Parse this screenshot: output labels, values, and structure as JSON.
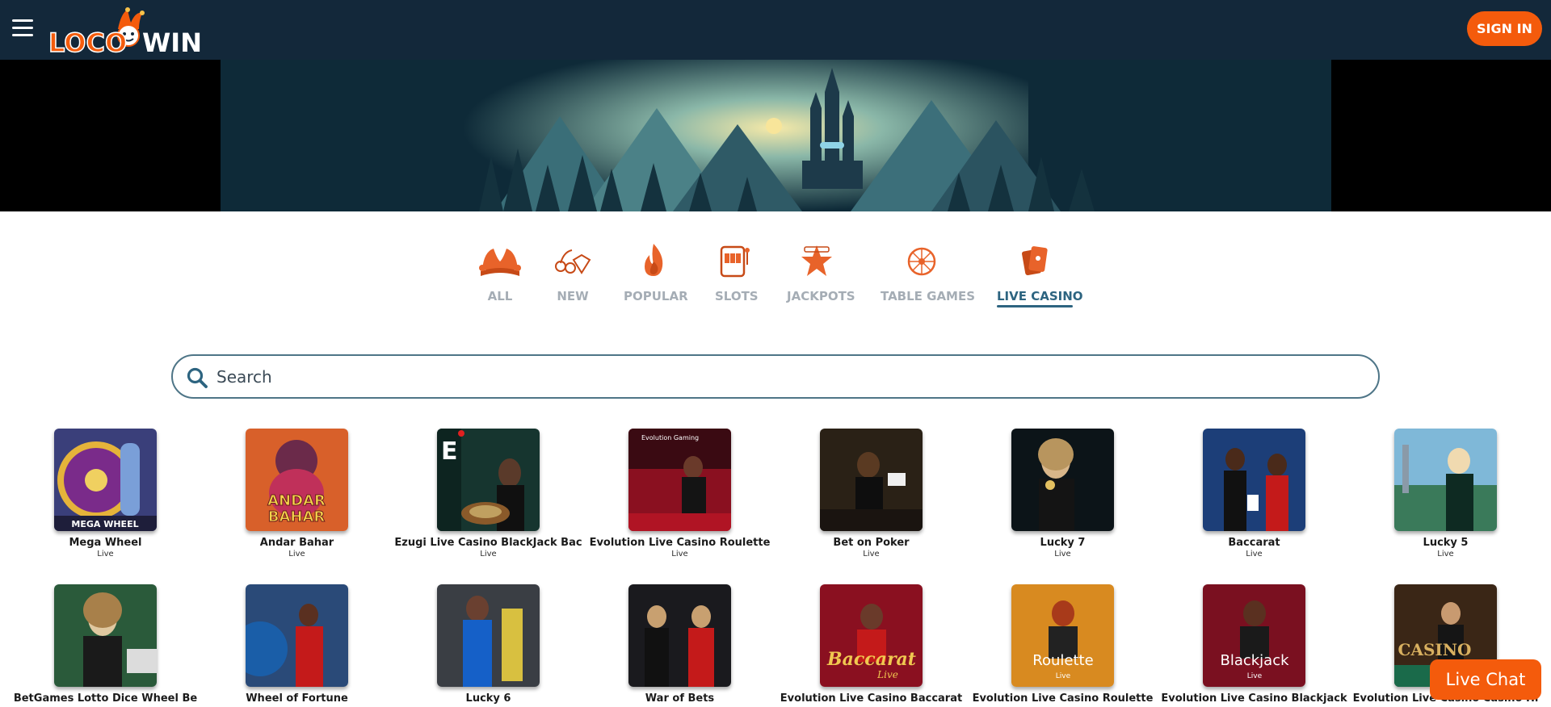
{
  "header": {
    "menu_icon": "hamburger-icon",
    "logo_text": "LOCOWIN",
    "signin_label": "SIGN IN",
    "accent": "#f45b0c",
    "bg": "#13283a"
  },
  "categories": [
    {
      "label": "ALL",
      "icon": "jester-hat-icon",
      "active": false
    },
    {
      "label": "NEW",
      "icon": "cherries-diamond-icon",
      "active": false
    },
    {
      "label": "POPULAR",
      "icon": "flame-icon",
      "active": false
    },
    {
      "label": "SLOTS",
      "icon": "slot-machine-icon",
      "active": false
    },
    {
      "label": "JACKPOTS",
      "icon": "star-jackpot-icon",
      "active": false
    },
    {
      "label": "TABLE GAMES",
      "icon": "roulette-wheel-icon",
      "active": false
    },
    {
      "label": "LIVE CASINO",
      "icon": "playing-cards-icon",
      "active": true
    }
  ],
  "search": {
    "placeholder": "Search",
    "value": ""
  },
  "games": [
    {
      "title": "Mega Wheel",
      "tag": "Live"
    },
    {
      "title": "Andar Bahar",
      "tag": "Live"
    },
    {
      "title": "Ezugi Live Casino BlackJack Bac",
      "tag": "Live"
    },
    {
      "title": "Evolution Live Casino Roulette",
      "tag": "Live"
    },
    {
      "title": "Bet on Poker",
      "tag": "Live"
    },
    {
      "title": "Lucky 7",
      "tag": "Live"
    },
    {
      "title": "Baccarat",
      "tag": "Live"
    },
    {
      "title": "Lucky 5",
      "tag": "Live"
    },
    {
      "title": "BetGames Lotto Dice Wheel Be",
      "tag": ""
    },
    {
      "title": "Wheel of Fortune",
      "tag": ""
    },
    {
      "title": "Lucky 6",
      "tag": ""
    },
    {
      "title": "War of Bets",
      "tag": ""
    },
    {
      "title": "Evolution Live Casino Baccarat",
      "tag": ""
    },
    {
      "title": "Evolution Live Casino Roulette",
      "tag": ""
    },
    {
      "title": "Evolution Live Casino Blackjack",
      "tag": ""
    },
    {
      "title": "Evolution Live Casino Casino Hi",
      "tag": ""
    }
  ],
  "thumb_text": {
    "mega_wheel": "MEGA WHEEL",
    "andar": "ANDAR",
    "bahar": "BAHAR",
    "ezugi": "E",
    "evolution": "Evolution Gaming",
    "baccarat": "Baccarat",
    "baccarat_sub": "Live",
    "roulette": "Roulette",
    "roulette_sub": "Live",
    "blackjack": "Blackjack",
    "blackjack_sub": "Live",
    "casino": "CASINO"
  },
  "livechat_label": "Live Chat"
}
